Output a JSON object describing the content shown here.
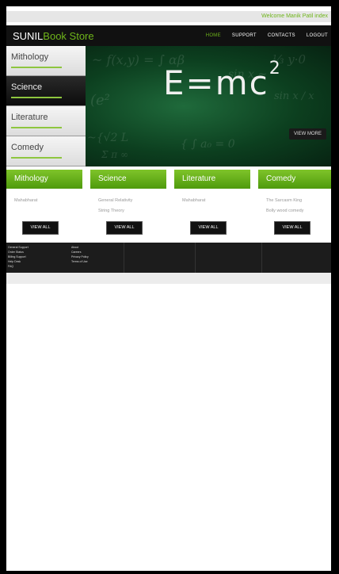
{
  "welcome_text": "Welcome  Manik Patil index",
  "logo": {
    "part1": "SUNIL",
    "part2": "Book Store"
  },
  "nav": [
    "HOME",
    "SUPPORT",
    "CONTACTS",
    "LOGOUT"
  ],
  "sidebar": [
    {
      "label": "Mithology"
    },
    {
      "label": "Science"
    },
    {
      "label": "Literature"
    },
    {
      "label": "Comedy"
    }
  ],
  "hero": {
    "formula_main": "E=mc",
    "formula_sup": "2",
    "button": "VIEW MORE"
  },
  "categories": [
    {
      "title": "Mithology",
      "items": [
        "Mahabharat"
      ],
      "button": "VIEW ALL"
    },
    {
      "title": "Science",
      "items": [
        "General Relativity",
        "String Theory"
      ],
      "button": "VIEW ALL"
    },
    {
      "title": "Literature",
      "items": [
        "Mahabharat"
      ],
      "button": "VIEW ALL"
    },
    {
      "title": "Comedy",
      "items": [
        "The Sarcasm King",
        "Bolly wood comedy"
      ],
      "button": "VIEW ALL"
    }
  ],
  "footer": {
    "col1": [
      "General Support",
      "Order Status",
      "Billing Support",
      "Help Desk",
      "FAQ"
    ],
    "col2": [
      "About",
      "Careers",
      "Privacy Policy",
      "Terms of Use"
    ]
  }
}
